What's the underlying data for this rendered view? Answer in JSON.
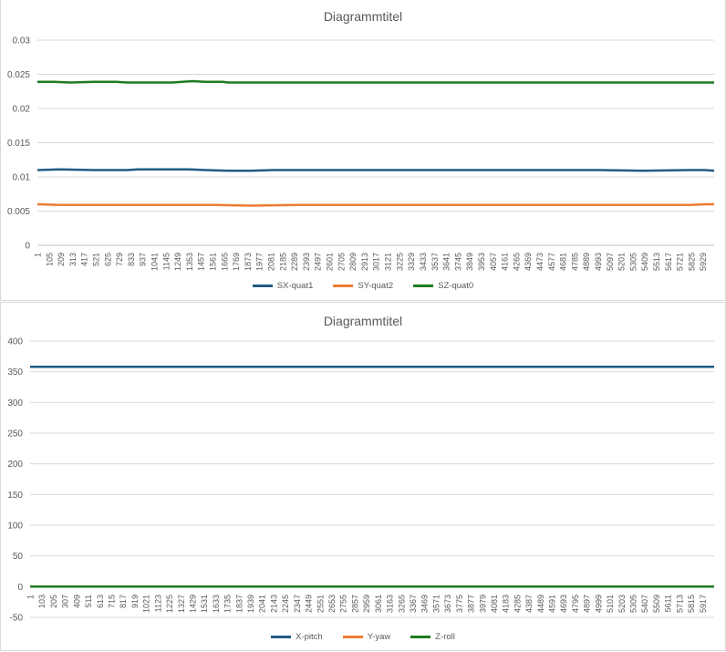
{
  "chart_data": [
    {
      "type": "line",
      "title": "Diagrammtitel",
      "xlabel": "",
      "ylabel": "",
      "ylim": [
        0,
        0.03
      ],
      "yticks": [
        "0",
        "0.005",
        "0.01",
        "0.015",
        "0.02",
        "0.025",
        "0.03"
      ],
      "x_range": [
        1,
        6029
      ],
      "x_tick_start": 1,
      "x_tick_step": 104,
      "x_tick_labels": [
        "1",
        "105",
        "209",
        "313",
        "417",
        "521",
        "625",
        "729",
        "833",
        "937",
        "1041",
        "1145",
        "1249",
        "1353",
        "1457",
        "1561",
        "1665",
        "1769",
        "1873",
        "1977",
        "2081",
        "2185",
        "2289",
        "2393",
        "2497",
        "2601",
        "2705",
        "2809",
        "2913",
        "3017",
        "3121",
        "3225",
        "3329",
        "3433",
        "3537",
        "3641",
        "3745",
        "3849",
        "3953",
        "4057",
        "4161",
        "4265",
        "4369",
        "4473",
        "4577",
        "4681",
        "4785",
        "4889",
        "4993",
        "5097",
        "5201",
        "5305",
        "5409",
        "5513",
        "5617",
        "5721",
        "5825",
        "5929"
      ],
      "grid": true,
      "legend_position": "bottom",
      "series": [
        {
          "name": "SX-quat1",
          "color": "#1f5c85",
          "x": [
            1,
            200,
            500,
            800,
            900,
            1100,
            1350,
            1500,
            1700,
            1900,
            2100,
            2300,
            2600,
            3000,
            3400,
            3800,
            4200,
            4600,
            5000,
            5400,
            5800,
            5950,
            6029
          ],
          "y": [
            0.011,
            0.0111,
            0.011,
            0.011,
            0.0111,
            0.0111,
            0.0111,
            0.011,
            0.0109,
            0.0109,
            0.011,
            0.011,
            0.011,
            0.011,
            0.011,
            0.011,
            0.011,
            0.011,
            0.011,
            0.0109,
            0.011,
            0.011,
            0.0109
          ]
        },
        {
          "name": "SY-quat2",
          "color": "#ed7d31",
          "x": [
            1,
            200,
            500,
            800,
            1100,
            1350,
            1600,
            1900,
            2300,
            2800,
            3400,
            4000,
            4600,
            5200,
            5800,
            5950,
            6029
          ],
          "y": [
            0.006,
            0.0059,
            0.0059,
            0.0059,
            0.0059,
            0.0059,
            0.0059,
            0.0058,
            0.0059,
            0.0059,
            0.0059,
            0.0059,
            0.0059,
            0.0059,
            0.0059,
            0.006,
            0.006
          ],
          "note_removed": true
        },
        {
          "name": "SZ-quat0",
          "color": "#1e7b1e",
          "x": [
            1,
            150,
            300,
            500,
            700,
            800,
            1200,
            1380,
            1500,
            1650,
            1700,
            2500,
            3500,
            4500,
            5500,
            6029
          ],
          "y": [
            0.0239,
            0.0239,
            0.0238,
            0.0239,
            0.0239,
            0.0238,
            0.0238,
            0.024,
            0.0239,
            0.0239,
            0.0238,
            0.0238,
            0.0238,
            0.0238,
            0.0238,
            0.0238
          ]
        }
      ]
    },
    {
      "type": "line",
      "title": "Diagrammtitel",
      "xlabel": "",
      "ylabel": "",
      "ylim": [
        -50,
        400
      ],
      "yticks": [
        "-50",
        "0",
        "50",
        "100",
        "150",
        "200",
        "250",
        "300",
        "350",
        "400"
      ],
      "x_range": [
        1,
        6019
      ],
      "x_tick_start": 1,
      "x_tick_step": 102,
      "x_tick_labels": [
        "1",
        "103",
        "205",
        "307",
        "409",
        "511",
        "613",
        "715",
        "817",
        "919",
        "1021",
        "1123",
        "1225",
        "1327",
        "1429",
        "1531",
        "1633",
        "1735",
        "1837",
        "1939",
        "2041",
        "2143",
        "2245",
        "2347",
        "2449",
        "2551",
        "2653",
        "2755",
        "2857",
        "2959",
        "3061",
        "3163",
        "3265",
        "3367",
        "3469",
        "3571",
        "3673",
        "3775",
        "3877",
        "3979",
        "4081",
        "4183",
        "4285",
        "4387",
        "4489",
        "4591",
        "4693",
        "4795",
        "4897",
        "4999",
        "5101",
        "5203",
        "5305",
        "5407",
        "5509",
        "5611",
        "5713",
        "5815",
        "5917"
      ],
      "grid": true,
      "legend_position": "bottom",
      "series": [
        {
          "name": "X-pitch",
          "color": "#1f5c85",
          "x": [
            1,
            6019
          ],
          "y": [
            358,
            358
          ]
        },
        {
          "name": "Y-yaw",
          "color": "#ed7d31",
          "x": [
            1,
            6019
          ],
          "y": [
            0,
            0
          ]
        },
        {
          "name": "Z-roll",
          "color": "#1e7b1e",
          "x": [
            1,
            6019
          ],
          "y": [
            0,
            0
          ]
        }
      ]
    }
  ]
}
